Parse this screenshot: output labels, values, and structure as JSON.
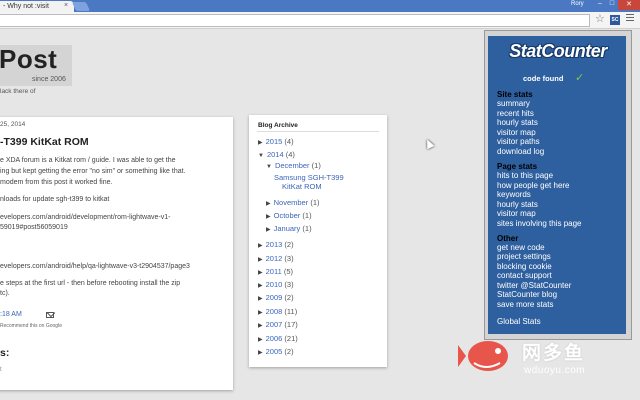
{
  "browser": {
    "tab_title": "- Why not :visit",
    "tab_close": "×",
    "user": "Rory",
    "win_min": "–",
    "win_max": "□",
    "win_close": "✕",
    "star": "☆",
    "ext_badge": "SC"
  },
  "blog": {
    "title": "Post",
    "since": "since 2006",
    "description": "lack there of"
  },
  "post": {
    "date": "25, 2014",
    "title": "-T399 KitKat ROM",
    "lines": [
      "e XDA forum is a Kitkat rom / guide.  I was able to get the",
      "ing but kept getting the error \"no sim\" or something like that.",
      "modem from this post it worked fine.",
      "nloads for update sgh-t399 to kitkat",
      "evelopers.com/android/development/rom-lightwave-v1-",
      "59019#post56059019",
      "evelopers.com/android/help/qa-lightwave-v3-t2904537/page3",
      "e steps at the first url - then before rebooting install the zip",
      "tc)."
    ],
    "time": ":18 AM",
    "recommend": "Recommend this on Google",
    "comments_heading": "s:",
    "comments_frag": "t"
  },
  "archive": {
    "title": "Blog Archive",
    "rows": [
      {
        "tri": "▶",
        "label": "2015",
        "count": "(4)"
      },
      {
        "tri": "▼",
        "label": "2014",
        "count": "(4)"
      },
      {
        "tri": "▼",
        "label": "December",
        "count": "(1)"
      },
      {
        "tri": "▶",
        "label": "November",
        "count": "(1)"
      },
      {
        "tri": "▶",
        "label": "October",
        "count": "(1)"
      },
      {
        "tri": "▶",
        "label": "January",
        "count": "(1)"
      },
      {
        "tri": "▶",
        "label": "2013",
        "count": "(2)"
      },
      {
        "tri": "▶",
        "label": "2012",
        "count": "(3)"
      },
      {
        "tri": "▶",
        "label": "2011",
        "count": "(5)"
      },
      {
        "tri": "▶",
        "label": "2010",
        "count": "(3)"
      },
      {
        "tri": "▶",
        "label": "2009",
        "count": "(2)"
      },
      {
        "tri": "▶",
        "label": "2008",
        "count": "(11)"
      },
      {
        "tri": "▶",
        "label": "2007",
        "count": "(17)"
      },
      {
        "tri": "▶",
        "label": "2006",
        "count": "(21)"
      },
      {
        "tri": "▶",
        "label": "2005",
        "count": "(2)"
      }
    ],
    "post_line1": "Samsung SGH-T399",
    "post_line2": "KitKat ROM"
  },
  "statcounter": {
    "logo": "StatCounter",
    "code_found": "code found",
    "check": "✓",
    "site_stats_heading": "Site stats",
    "site_stats": [
      "summary",
      "recent hits",
      "hourly stats",
      "visitor map",
      "visitor paths",
      "download log"
    ],
    "page_stats_heading": "Page stats",
    "page_stats": [
      "hits to this page",
      "how people get here",
      "keywords",
      "hourly stats",
      "visitor map",
      "sites involving this page"
    ],
    "other_heading": "Other",
    "other": [
      "get new code",
      "project settings",
      "blocking cookie",
      "contact support",
      "twitter @StatCounter",
      "StatCounter blog",
      "save more stats"
    ],
    "global_stats": "Global Stats"
  },
  "watermark": {
    "chinese": "网多鱼",
    "url": "wduoyu.com",
    "fish_color": "#e8554a"
  }
}
